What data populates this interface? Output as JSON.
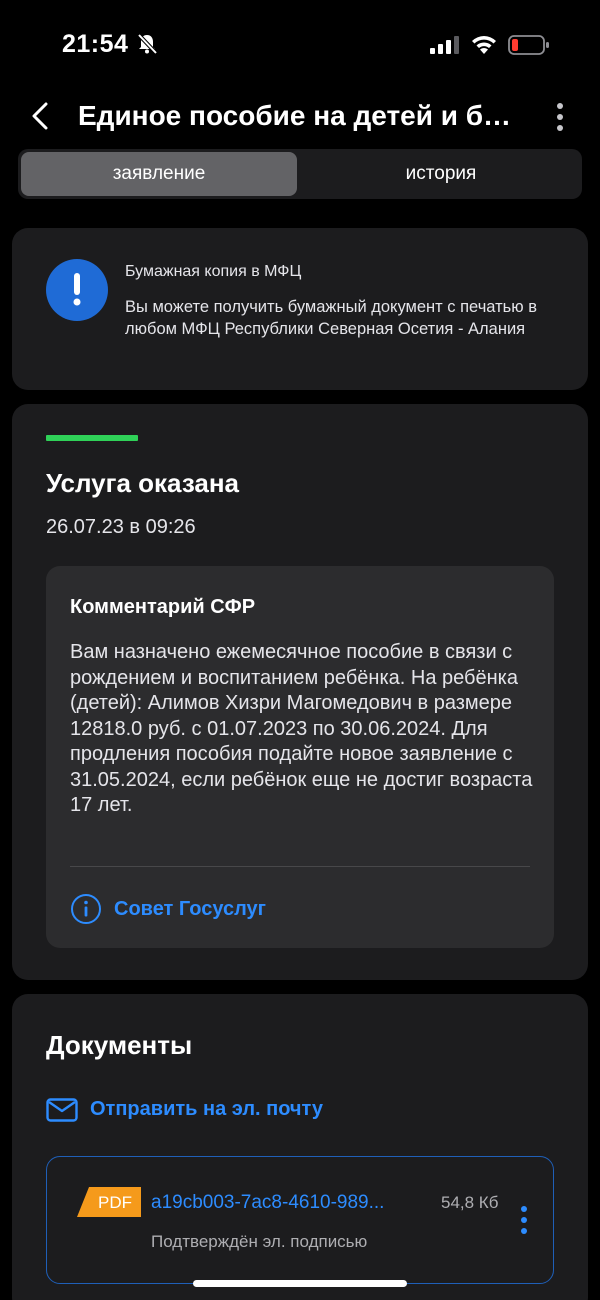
{
  "status_bar": {
    "time": "21:54"
  },
  "header": {
    "title": "Единое пособие на детей и бе..."
  },
  "tabs": [
    {
      "label": "заявление",
      "active": true
    },
    {
      "label": "история",
      "active": false
    }
  ],
  "info_card": {
    "title": "Бумажная копия в МФЦ",
    "text": "Вы можете получить бумажный документ с печатью в любом МФЦ Республики Северная Осетия - Алания",
    "icon": "exclamation-icon"
  },
  "status_card": {
    "title": "Услуга оказана",
    "date": "26.07.23 в 09:26",
    "status_color": "#2fd158",
    "comment": {
      "title": "Комментарий СФР",
      "text": "Вам назначено ежемесячное пособие в связи с рождением и воспитанием ребёнка. На ребёнка (детей): Алимов Хизри Магомедович в размере 12818.0 руб. с 01.07.2023 по 30.06.2024. Для продления пособия подайте новое заявление с 31.05.2024, если ребёнок еще не достиг возраста 17 лет.",
      "advice_link": "Совет Госуслуг"
    }
  },
  "documents": {
    "title": "Документы",
    "send_email": "Отправить на эл. почту",
    "files": [
      {
        "badge": "PDF",
        "name": "a19cb003-7ac8-4610-989...",
        "size": "54,8 Кб",
        "signature": "Подтверждён эл. подписью"
      }
    ]
  },
  "colors": {
    "accent": "#2d8cff",
    "info_blue": "#1f6bd6",
    "pdf_orange": "#f59a1b",
    "card_bg": "#1c1c1e"
  }
}
